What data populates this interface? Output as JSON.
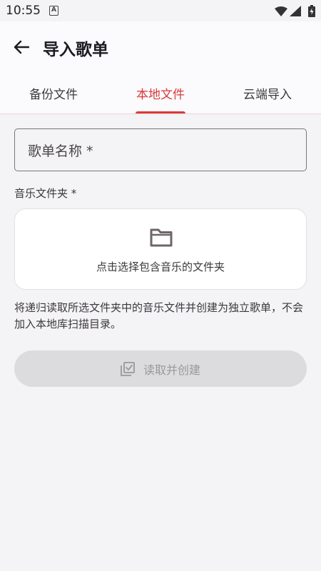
{
  "status_bar": {
    "time": "10:55",
    "notification_letter": "A"
  },
  "app_bar": {
    "title": "导入歌单",
    "back_icon": "arrow-back-icon"
  },
  "tabs": [
    {
      "label": "备份文件",
      "active": false
    },
    {
      "label": "本地文件",
      "active": true
    },
    {
      "label": "云端导入",
      "active": false
    }
  ],
  "form": {
    "name_placeholder": "歌单名称 *",
    "folder_label": "音乐文件夹 *",
    "folder_picker_text": "点击选择包含音乐的文件夹",
    "folder_icon": "folder-icon",
    "description": "将递归读取所选文件夹中的音乐文件并创建为独立歌单，不会加入本地库扫描目录。",
    "create_button": "读取并创建",
    "create_icon": "library-add-check-icon",
    "create_enabled": false
  },
  "colors": {
    "accent": "#d83a3a",
    "background": "#f4f3f6",
    "disabled_button": "#dcdbdd"
  }
}
